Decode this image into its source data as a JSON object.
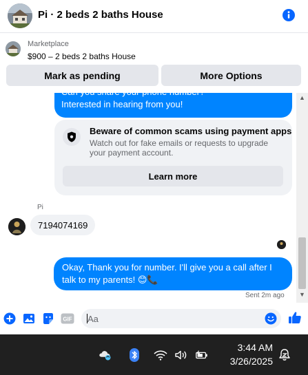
{
  "header": {
    "title": "Pi · 2 beds 2 baths House",
    "icons": {
      "avatar": "house-photo-avatar",
      "info": "info-icon"
    }
  },
  "listing": {
    "kind": "Marketplace",
    "name": "$900 – 2 beds 2 baths House",
    "mark_pending": "Mark as pending",
    "more_options": "More Options"
  },
  "chat": {
    "outgoing_1": {
      "line1": "Can you share your phone number?",
      "line2": "Interested in hearing from you!"
    },
    "scam_warning": {
      "heading": "Beware of common scams using payment apps",
      "description": "Watch out for fake emails or requests to upgrade your payment account.",
      "learn_more": "Learn more",
      "icon": "shield-icon"
    },
    "sender_name": "Pi",
    "incoming_1": "7194074169",
    "outgoing_2": "Okay, Thank you for number. I'll give you a call after I talk to my parents! 😊📞",
    "status": "Sent 2m ago"
  },
  "composer": {
    "placeholder": "Aa",
    "icons": [
      "plus-circle-icon",
      "photo-icon",
      "sticker-icon",
      "gif-icon",
      "emoji-icon",
      "thumbs-up-icon"
    ],
    "gif_label": "GIF"
  },
  "taskbar": {
    "time": "3:44 AM",
    "date": "3/26/2025",
    "icons": [
      "onedrive-sync-icon",
      "bluetooth-icon",
      "wifi-icon",
      "volume-icon",
      "battery-icon",
      "notification-bell-icon"
    ]
  },
  "colors": {
    "accent": "#0084ff",
    "bubble_in": "#f0f2f5",
    "button_bg": "#e4e6eb",
    "taskbar": "#202020",
    "info": "#0866ff"
  }
}
